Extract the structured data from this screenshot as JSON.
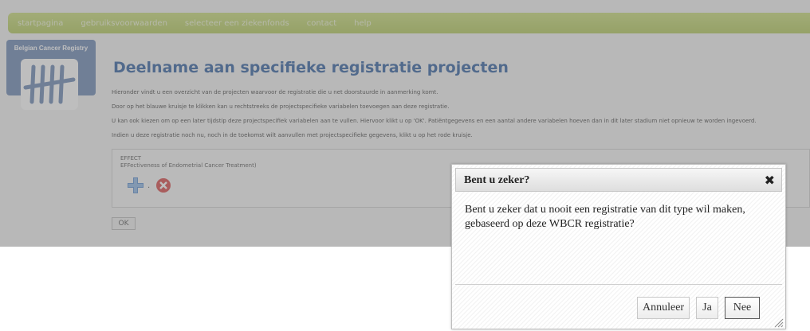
{
  "nav": {
    "items": [
      "startpagina",
      "gebruiksvoorwaarden",
      "selecteer een ziekenfonds",
      "contact",
      "help"
    ]
  },
  "logo": {
    "text": "Belgian Cancer Registry"
  },
  "page": {
    "title": "Deelname aan specifieke registratie projecten",
    "paragraphs": [
      "Hieronder vindt u een overzicht van de projecten waarvoor de registratie die u net doorstuurde in aanmerking komt.",
      "Door op het blauwe kruisje te klikken kan u rechtstreeks de projectspecifieke variabelen toevoegen aan deze registratie.",
      "U kan ook kiezen om op een later tijdstip deze projectspecifiek variabelen aan te vullen. Hiervoor klikt u op 'OK'. Patiëntgegevens en een aantal andere variabelen hoeven dan in dit later stadium niet opnieuw te worden ingevoerd.",
      "Indien u deze registratie noch nu, noch in de toekomst wilt aanvullen met projectspecifieke gegevens, klikt u op het rode kruisje."
    ],
    "project": {
      "code": "EFFECT",
      "name": "EFFectiveness of Endometrial Cancer Treatment)",
      "separator": "."
    },
    "ok_label": "OK"
  },
  "dialog": {
    "title": "Bent u zeker?",
    "close_glyph": "✖",
    "message": "Bent u zeker dat u nooit een registratie van dit type wil maken, gebaseerd op deze WBCR registratie?",
    "buttons": {
      "cancel": "Annuleer",
      "yes": "Ja",
      "no": "Nee"
    }
  },
  "colors": {
    "nav": "#b8cd63",
    "title": "#2f5ea0",
    "logo_bg": "#6a86b3",
    "add_icon": "#5a8fd0",
    "reject_icon": "#d64545"
  },
  "icons": {
    "add": "blue-plus-icon",
    "reject": "red-x-icon",
    "close": "close-icon",
    "resize": "resize-grip-icon"
  }
}
